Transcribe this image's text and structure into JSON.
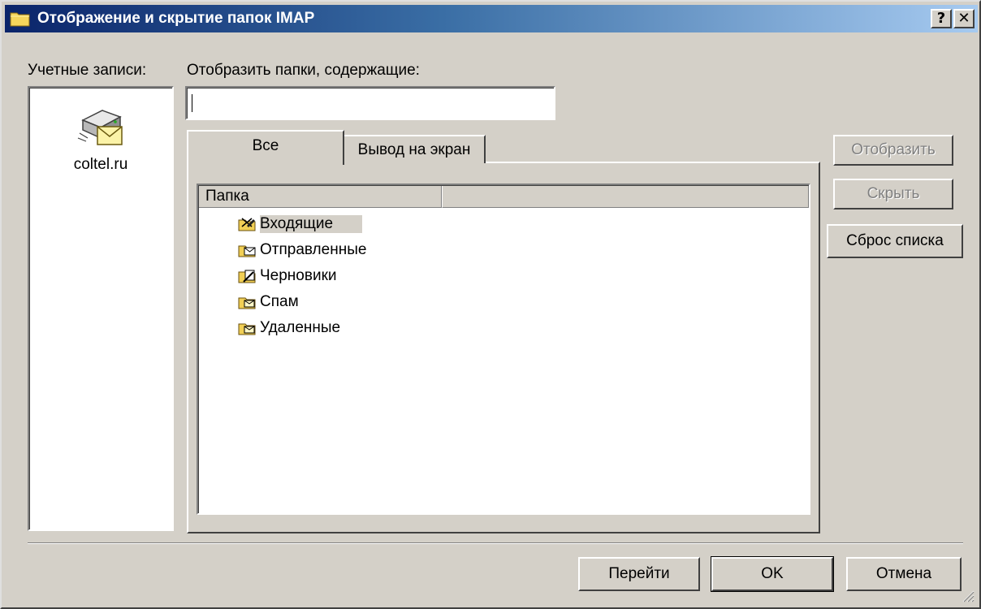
{
  "window": {
    "title": "Отображение и скрытие папок IMAP",
    "help_label": "?",
    "close_label": "✕"
  },
  "accounts": {
    "label": "Учетные записи:",
    "items": [
      {
        "name": "coltel.ru",
        "icon": "mail-server-icon"
      }
    ]
  },
  "filter": {
    "label": "Отобразить папки, содержащие:",
    "value": ""
  },
  "tabs": [
    {
      "label": "Все",
      "active": true
    },
    {
      "label": "Вывод на экран",
      "active": false
    }
  ],
  "folder_list": {
    "column_header": "Папка",
    "items": [
      {
        "label": "Входящие",
        "icon": "inbox-folder-icon",
        "selected": true
      },
      {
        "label": "Отправленные",
        "icon": "sent-folder-icon",
        "selected": false
      },
      {
        "label": "Черновики",
        "icon": "drafts-folder-icon",
        "selected": false
      },
      {
        "label": "Спам",
        "icon": "spam-folder-icon",
        "selected": false
      },
      {
        "label": "Удаленные",
        "icon": "deleted-folder-icon",
        "selected": false
      }
    ]
  },
  "side_buttons": {
    "show_label": "Отобразить",
    "hide_label": "Скрыть",
    "reset_label": "Сброс списка"
  },
  "footer": {
    "goto_label": "Перейти",
    "ok_label": "OK",
    "cancel_label": "Отмена"
  },
  "colors": {
    "title_gradient_start": "#0a246a",
    "title_gradient_end": "#a6caf0",
    "dialog_face": "#d4d0c8",
    "disabled_text": "#808080"
  }
}
